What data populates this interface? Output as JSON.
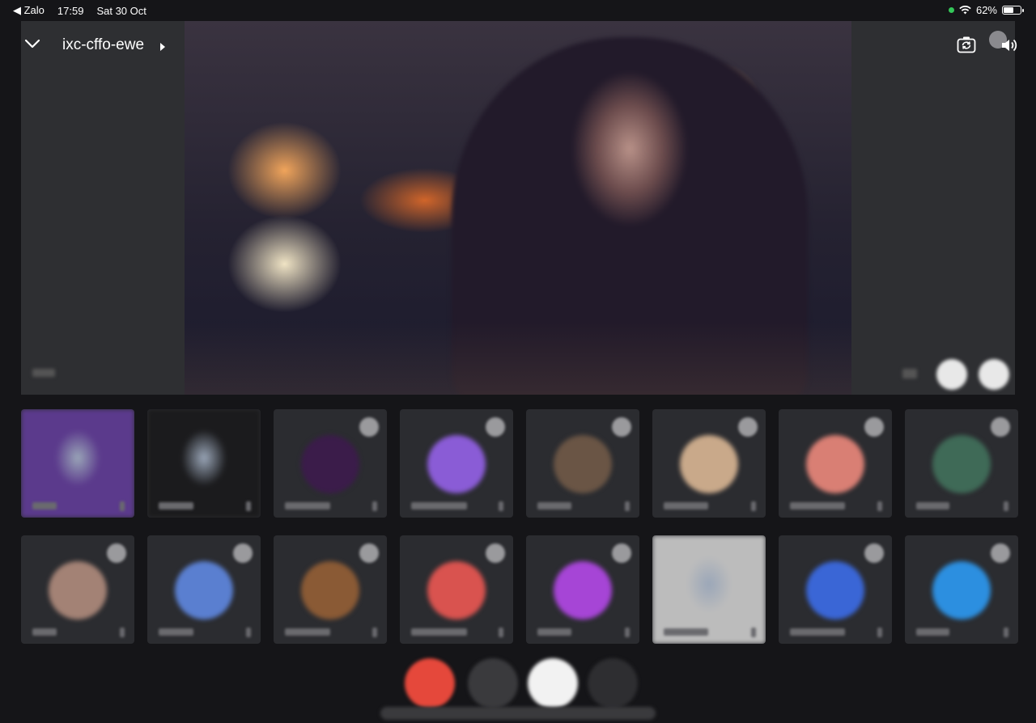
{
  "status_bar": {
    "back_app": "Zalo",
    "time": "17:59",
    "date": "Sat 30 Oct",
    "battery": "62%",
    "battery_level": 0.62
  },
  "meeting": {
    "code": "ixc-cffo-ewe"
  },
  "icons": {
    "collapse": "chevron-down-icon",
    "meeting_info": "caret-right-icon",
    "switch_camera": "camera-switch-icon",
    "audio_output": "speaker-icon",
    "muted_badge": "mic-off-icon"
  },
  "colors": {
    "background": "#151518",
    "tile": "#2b2c30",
    "end_call": "#e5483b",
    "accent_green": "#34c759"
  },
  "participants_row1": [
    {
      "avatar_color": "#5b3a8c",
      "type": "video"
    },
    {
      "avatar_color": "#1b1b1d",
      "type": "video"
    },
    {
      "avatar_color": "#3b1c4a",
      "type": "avatar"
    },
    {
      "avatar_color": "#8a5cd6",
      "type": "avatar"
    },
    {
      "avatar_color": "#6a5545",
      "type": "avatar"
    },
    {
      "avatar_color": "#c9a98a",
      "type": "avatar"
    },
    {
      "avatar_color": "#d97f74",
      "type": "avatar"
    },
    {
      "avatar_color": "#3f6a57",
      "type": "avatar"
    }
  ],
  "participants_row2": [
    {
      "avatar_color": "#a38275",
      "type": "avatar"
    },
    {
      "avatar_color": "#5a7fd0",
      "type": "avatar"
    },
    {
      "avatar_color": "#8a5a35",
      "type": "avatar"
    },
    {
      "avatar_color": "#d9534f",
      "type": "avatar"
    },
    {
      "avatar_color": "#a645d6",
      "type": "avatar"
    },
    {
      "avatar_color": "#bcbcbc",
      "type": "video"
    },
    {
      "avatar_color": "#3a66d6",
      "type": "avatar"
    },
    {
      "avatar_color": "#2c8fe0",
      "type": "avatar"
    }
  ]
}
